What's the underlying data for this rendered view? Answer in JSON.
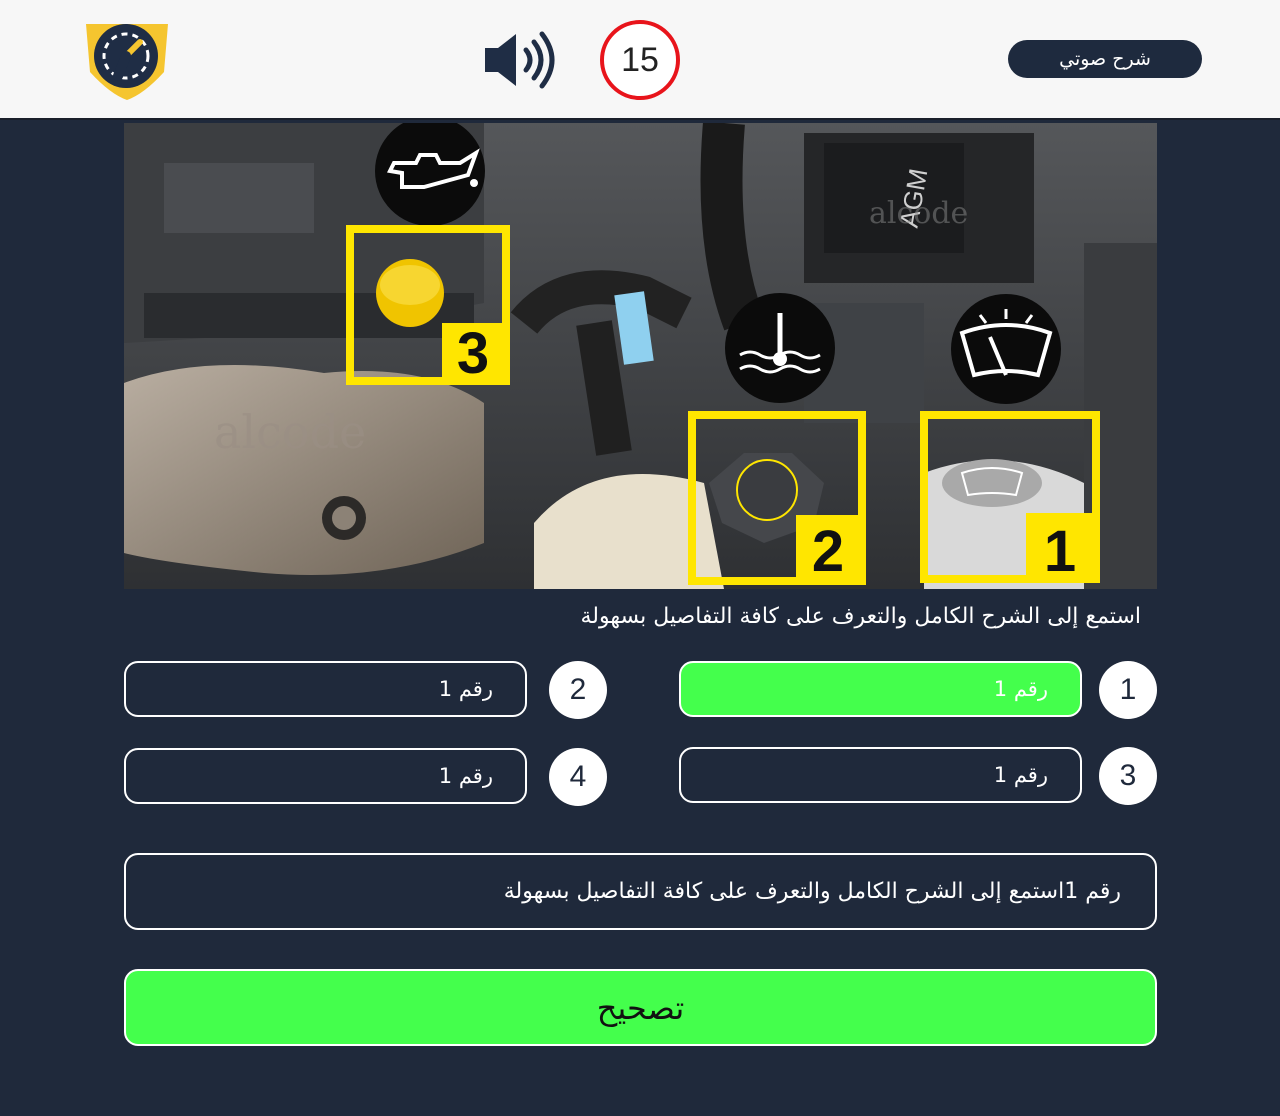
{
  "header": {
    "logo_icon": "speedometer-shield-icon",
    "speaker_icon": "speaker-volume-icon",
    "timer_value": "15",
    "audio_button_label": "شرح صوتي"
  },
  "image": {
    "watermark_left": "alcode",
    "watermark_right": "alcode",
    "battery_text": "AGM",
    "label_1": "1",
    "label_2": "2",
    "label_3": "3"
  },
  "prompt": "استمع إلى الشرح الكامل والتعرف على كافة التفاصيل بسهولة",
  "options": [
    {
      "number": "1",
      "value": "رقم 1",
      "selected": true
    },
    {
      "number": "2",
      "value": "رقم 1",
      "selected": false
    },
    {
      "number": "3",
      "value": "رقم 1",
      "selected": false
    },
    {
      "number": "4",
      "value": "رقم 1",
      "selected": false
    }
  ],
  "answer_text": "رقم 1استمع إلى الشرح الكامل والتعرف على كافة التفاصيل بسهولة",
  "check_button_label": "تصحيح",
  "colors": {
    "background": "#1f293b",
    "accent_green": "#44ff4c",
    "timer_red": "#e8141b",
    "logo_yellow": "#f5c52f",
    "highlight_yellow": "#ffe600"
  }
}
